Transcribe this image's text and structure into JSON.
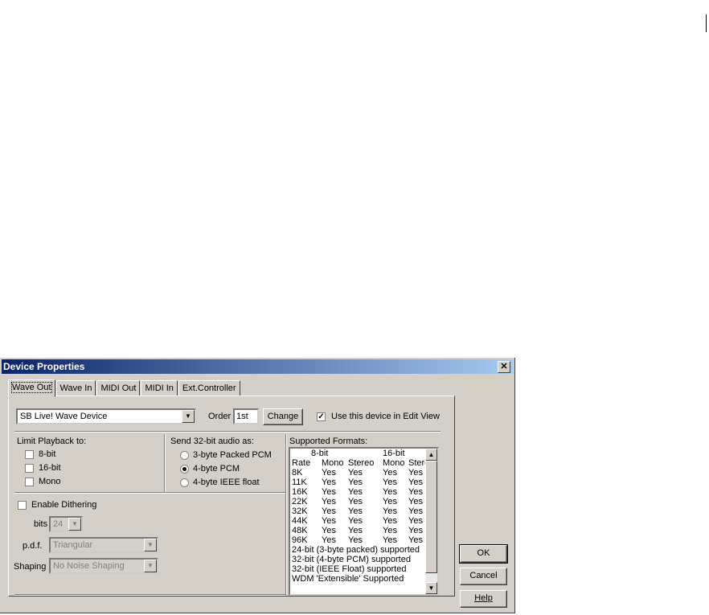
{
  "dialog": {
    "title": "Device Properties",
    "close_glyph": "✕",
    "tabs": [
      "Wave Out",
      "Wave In",
      "MIDI Out",
      "MIDI In",
      "Ext.Controller"
    ],
    "device_select": "SB Live! Wave Device",
    "order_label": "Order",
    "order_value": "1st",
    "change_label": "Change",
    "use_device_label": "Use this device in Edit View",
    "limit_label": "Limit Playback to:",
    "limit_options": [
      "8-bit",
      "16-bit",
      "Mono"
    ],
    "send32_label": "Send 32-bit audio as:",
    "send32_options": [
      "3-byte Packed PCM",
      "4-byte PCM",
      "4-byte IEEE float"
    ],
    "send32_selected": "4-byte PCM",
    "dither_label": "Enable Dithering",
    "bits_label": "bits",
    "bits_value": "24",
    "pdf_label": "p.d.f.",
    "pdf_value": "Triangular",
    "shaping_label": "Shaping",
    "shaping_value": "No Noise Shaping",
    "formats_label": "Supported Formats:",
    "formats_header1": [
      "8-bit",
      "16-bit"
    ],
    "formats_header2": [
      "Rate",
      "Mono",
      "Stereo",
      "Mono",
      "Stere"
    ],
    "formats_rows": [
      [
        "8K",
        "Yes",
        "Yes",
        "Yes",
        "Yes"
      ],
      [
        "11K",
        "Yes",
        "Yes",
        "Yes",
        "Yes"
      ],
      [
        "16K",
        "Yes",
        "Yes",
        "Yes",
        "Yes"
      ],
      [
        "22K",
        "Yes",
        "Yes",
        "Yes",
        "Yes"
      ],
      [
        "32K",
        "Yes",
        "Yes",
        "Yes",
        "Yes"
      ],
      [
        "44K",
        "Yes",
        "Yes",
        "Yes",
        "Yes"
      ],
      [
        "48K",
        "Yes",
        "Yes",
        "Yes",
        "Yes"
      ],
      [
        "96K",
        "Yes",
        "Yes",
        "Yes",
        "Yes"
      ]
    ],
    "formats_notes": [
      "24-bit (3-byte packed) supported",
      "32-bit (4-byte PCM) supported",
      "32-bit (IEEE Float) supported",
      "WDM 'Extensible' Supported"
    ],
    "ok_label": "OK",
    "cancel_label": "Cancel",
    "help_label": "Help"
  }
}
